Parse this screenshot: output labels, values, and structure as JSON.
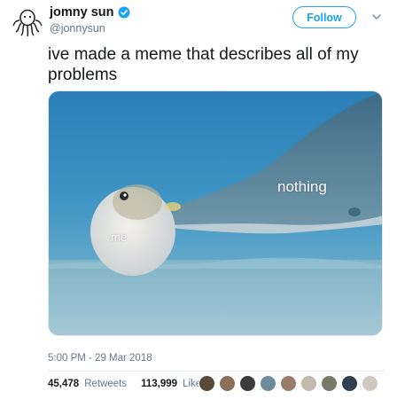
{
  "author": {
    "name": "jomny sun",
    "handle": "@jonnysun",
    "verified": true,
    "avatar_icon": "octopus-doodle-avatar"
  },
  "actions": {
    "follow_label": "Follow",
    "menu_icon": "chevron-down-icon"
  },
  "tweet": {
    "text": "ive made a meme that describes all of my problems",
    "timestamp": "5:00 PM - 29 Mar 2018"
  },
  "media": {
    "label_large": "nothing",
    "label_small": "me"
  },
  "stats": {
    "retweets_count": "45,478",
    "retweets_label": "Retweets",
    "likes_count": "113,999",
    "likes_label": "Likes",
    "liker_avatar_colors": [
      "#5a4a3a",
      "#8a6f5a",
      "#3b3b3b",
      "#6f8a9a",
      "#9b7c6a",
      "#c4b8a8",
      "#7a7a6a",
      "#2f3f4f",
      "#d0c8c0"
    ]
  },
  "colors": {
    "accent": "#1da1f2",
    "secondary_text": "#657786",
    "primary_text": "#14171a"
  }
}
